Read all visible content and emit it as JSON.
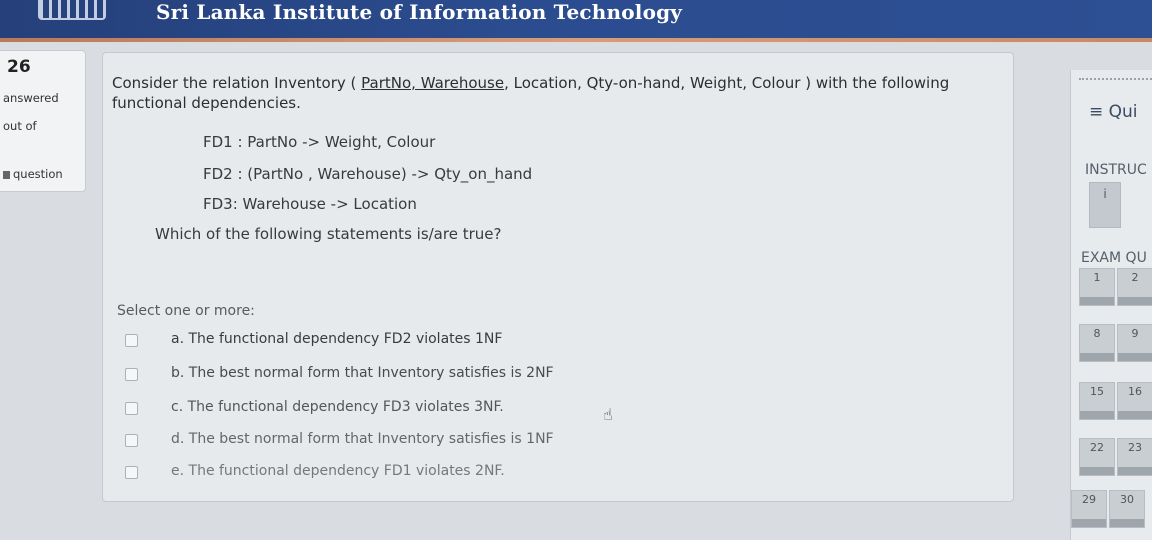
{
  "header": {
    "institution": "Sri Lanka Institute of Information Technology"
  },
  "question_info": {
    "number": "26",
    "status": "answered",
    "marks": "out of",
    "flag": "question"
  },
  "question": {
    "intro_prefix": "Consider the relation Inventory ( ",
    "intro_keys": "PartNo, Warehouse",
    "intro_suffix": ", Location, Qty-on-hand, Weight, Colour ) with the following functional dependencies.",
    "fds": [
      "FD1 : PartNo -> Weight, Colour",
      "FD2 : (PartNo , Warehouse) -> Qty_on_hand",
      "FD3: Warehouse -> Location"
    ],
    "prompt": "Which of the following statements is/are true?",
    "select_label": "Select one or more:",
    "options": [
      "a. The functional dependency FD2 violates 1NF",
      "b. The best normal form that Inventory satisfies is 2NF",
      "c. The functional dependency FD3 violates 3NF.",
      "d. The best normal form that Inventory satisfies is 1NF",
      "e. The functional dependency FD1 violates 2NF."
    ]
  },
  "nav": {
    "title": "Qui",
    "title_icon": "hamburger-icon",
    "instructions_label": "INSTRUC",
    "instructions_btn": "i",
    "exam_label": "EXAM QU",
    "buttons": [
      "1",
      "2",
      "8",
      "9",
      "15",
      "16",
      "22",
      "23",
      "29",
      "30"
    ]
  }
}
